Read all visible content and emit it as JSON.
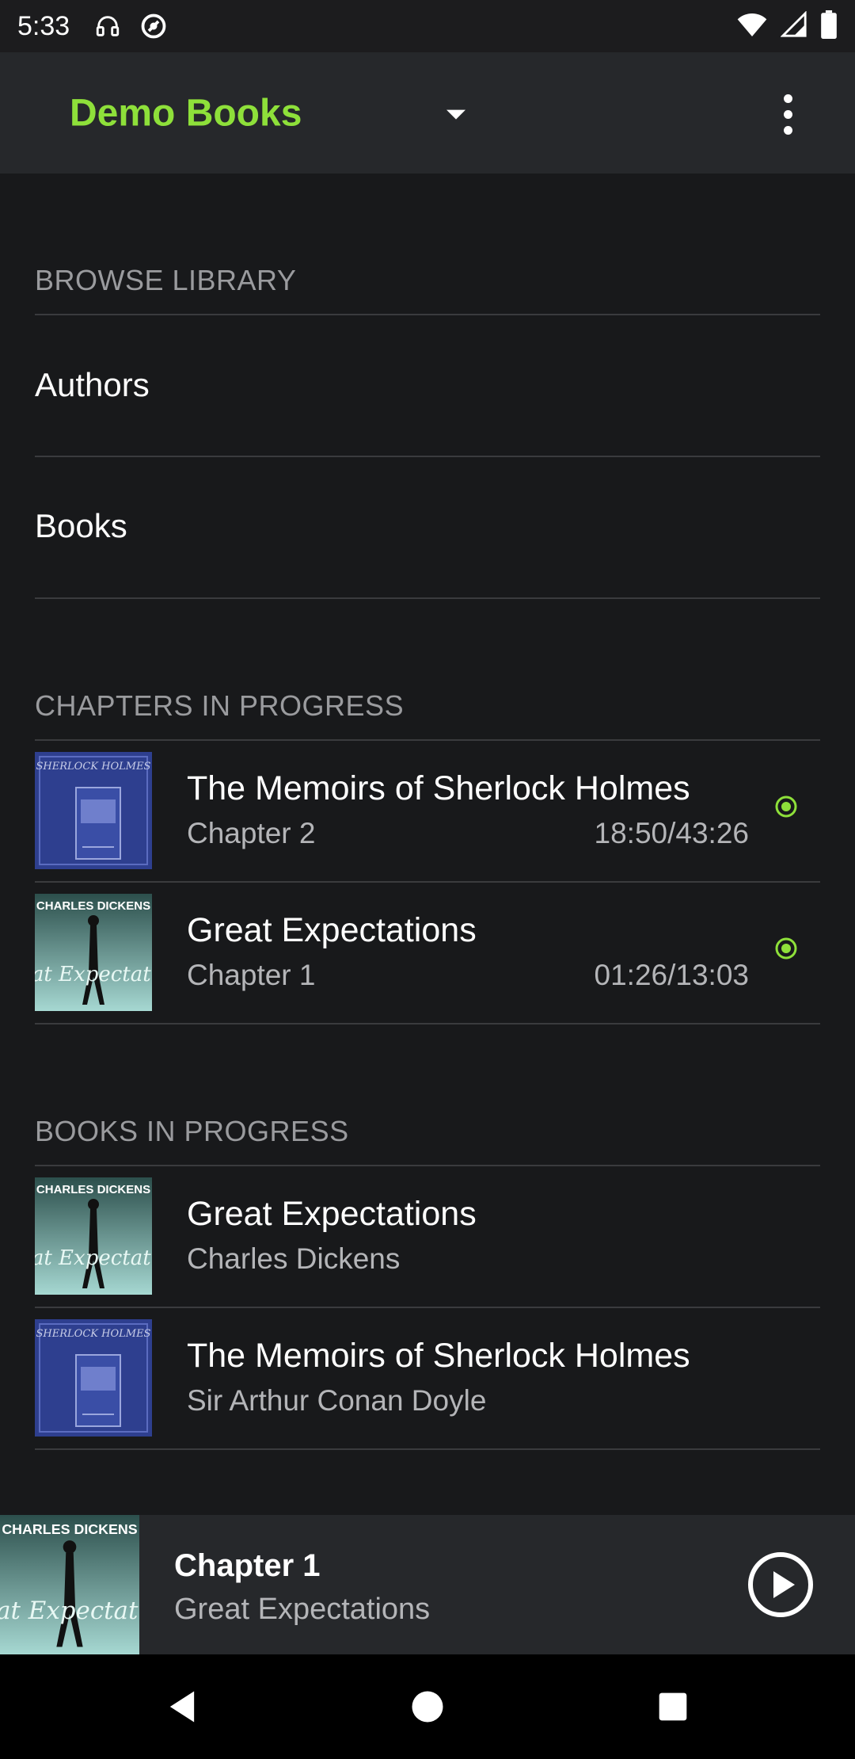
{
  "status_bar": {
    "time": "5:33",
    "icons": [
      "headset-icon",
      "at-sign-icon",
      "wifi-icon",
      "signal-icon",
      "battery-icon"
    ]
  },
  "app_bar": {
    "title": "Demo Books",
    "icons": [
      "dropdown-icon",
      "overflow-menu-icon"
    ]
  },
  "browse_library": {
    "header": "BROWSE LIBRARY",
    "items": [
      {
        "label": "Authors"
      },
      {
        "label": "Books"
      }
    ]
  },
  "chapters_in_progress": {
    "header": "CHAPTERS IN PROGRESS",
    "items": [
      {
        "title": "The Memoirs of Sherlock Holmes",
        "subtitle": "Chapter 2",
        "time": "18:50/43:26",
        "cover": "sherlock"
      },
      {
        "title": "Great Expectations",
        "subtitle": "Chapter 1",
        "time": "01:26/13:03",
        "cover": "dickens"
      }
    ]
  },
  "books_in_progress": {
    "header": "BOOKS IN PROGRESS",
    "items": [
      {
        "title": "Great Expectations",
        "subtitle": "Charles Dickens",
        "cover": "dickens"
      },
      {
        "title": "The Memoirs of Sherlock Holmes",
        "subtitle": "Sir Arthur Conan Doyle",
        "cover": "sherlock"
      }
    ]
  },
  "mini_player": {
    "title": "Chapter 1",
    "subtitle": "Great Expectations"
  },
  "covers": {
    "sherlock_text": "SHERLOCK HOLMES",
    "dickens_author": "CHARLES DICKENS",
    "dickens_title": "Great Expectations"
  },
  "colors": {
    "accent": "#8ee03a",
    "background": "#18191b",
    "app_bar": "#26282b"
  }
}
